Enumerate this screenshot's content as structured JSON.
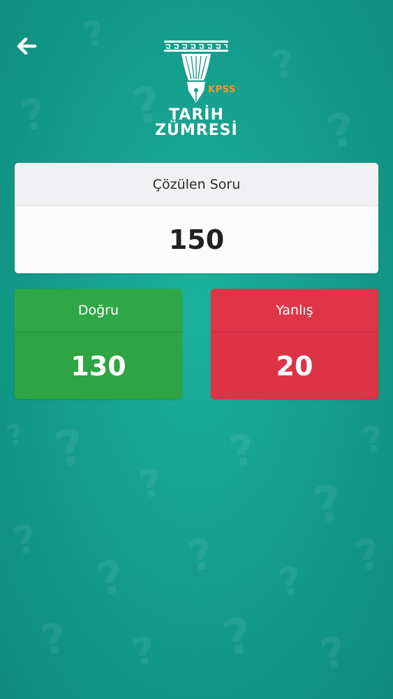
{
  "logo": {
    "badge": "KPSS",
    "line1": "TARİH",
    "line2": "ZÜMRESİ"
  },
  "stats": {
    "total_label": "Çözülen Soru",
    "total_value": "150",
    "correct_label": "Doğru",
    "correct_value": "130",
    "wrong_label": "Yanlış",
    "wrong_value": "20"
  },
  "colors": {
    "background": "#159f8d",
    "correct": "#2ea444",
    "wrong": "#dc3346",
    "badge": "#f39a2a"
  },
  "icons": {
    "back": "back-arrow-icon",
    "pattern": "question-mark-pattern"
  }
}
